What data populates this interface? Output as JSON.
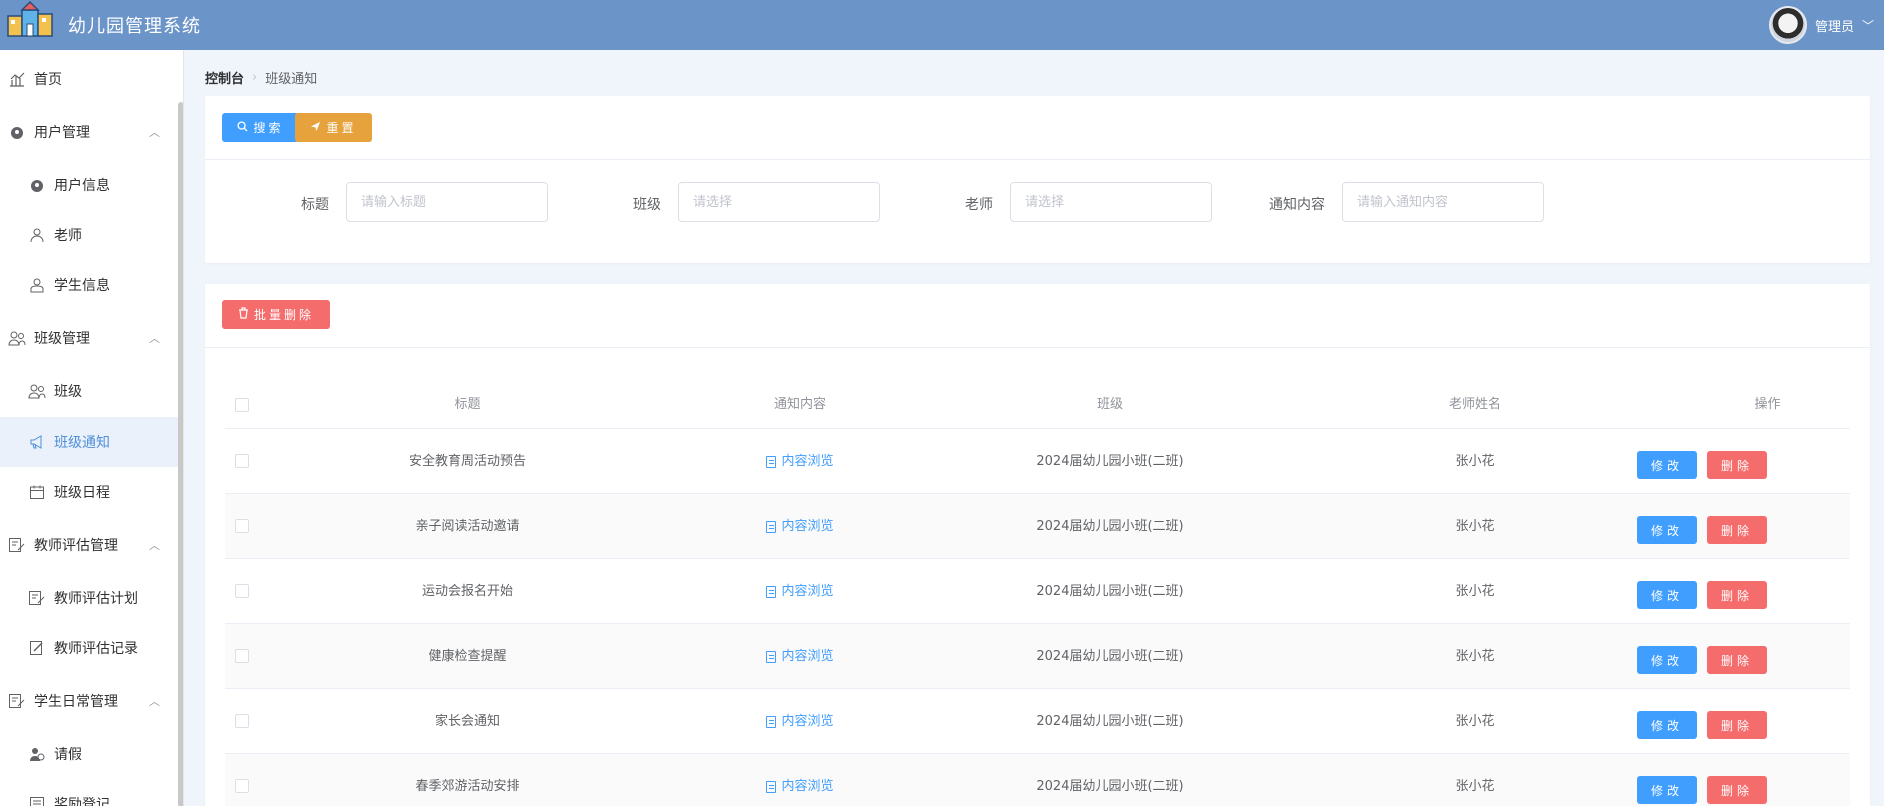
{
  "app": {
    "title": "幼儿园管理系统"
  },
  "user": {
    "name": "管理员"
  },
  "sidebar": {
    "items": [
      {
        "label": "首页"
      },
      {
        "label": "用户管理"
      },
      {
        "label": "用户信息"
      },
      {
        "label": "老师"
      },
      {
        "label": "学生信息"
      },
      {
        "label": "班级管理"
      },
      {
        "label": "班级"
      },
      {
        "label": "班级通知"
      },
      {
        "label": "班级日程"
      },
      {
        "label": "教师评估管理"
      },
      {
        "label": "教师评估计划"
      },
      {
        "label": "教师评估记录"
      },
      {
        "label": "学生日常管理"
      },
      {
        "label": "请假"
      },
      {
        "label": "奖励登记"
      }
    ]
  },
  "breadcrumb": {
    "home": "控制台",
    "current": "班级通知"
  },
  "toolbar": {
    "search_label": "搜索",
    "reset_label": "重置",
    "batch_delete_label": "批量删除"
  },
  "filters": {
    "title": {
      "label": "标题",
      "placeholder": "请输入标题"
    },
    "class": {
      "label": "班级",
      "placeholder": "请选择"
    },
    "teacher": {
      "label": "老师",
      "placeholder": "请选择"
    },
    "content": {
      "label": "通知内容",
      "placeholder": "请输入通知内容"
    }
  },
  "table": {
    "columns": [
      "标题",
      "通知内容",
      "班级",
      "老师姓名",
      "操作"
    ],
    "preview_label": "内容浏览",
    "edit_label": "修改",
    "delete_label": "删除",
    "rows": [
      {
        "title": "安全教育周活动预告",
        "class": "2024届幼儿园小班(二班)",
        "teacher": "张小花"
      },
      {
        "title": "亲子阅读活动邀请",
        "class": "2024届幼儿园小班(二班)",
        "teacher": "张小花"
      },
      {
        "title": "运动会报名开始",
        "class": "2024届幼儿园小班(二班)",
        "teacher": "张小花"
      },
      {
        "title": "健康检查提醒",
        "class": "2024届幼儿园小班(二班)",
        "teacher": "张小花"
      },
      {
        "title": "家长会通知",
        "class": "2024届幼儿园小班(二班)",
        "teacher": "张小花"
      },
      {
        "title": "春季郊游活动安排",
        "class": "2024届幼儿园小班(二班)",
        "teacher": "张小花"
      }
    ]
  },
  "colors": {
    "header": "#6b94c9",
    "primary": "#409eff",
    "warning": "#e6a23c",
    "danger": "#f56c6c",
    "active_menu_text": "#4f8fd8"
  }
}
